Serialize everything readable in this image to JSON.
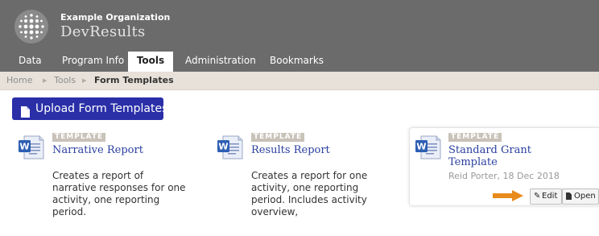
{
  "header": {
    "org_name": "Example Organization",
    "app_name": "DevResults"
  },
  "nav": {
    "items": [
      {
        "label": "Data"
      },
      {
        "label": "Program Info"
      },
      {
        "label": "Tools",
        "active": true
      },
      {
        "label": "Administration"
      },
      {
        "label": "Bookmarks"
      }
    ]
  },
  "breadcrumb": {
    "home": "Home",
    "tools": "Tools",
    "current": "Form Templates"
  },
  "upload_button": {
    "label": "Upload Form Templates",
    "icon": "document-icon"
  },
  "cards": [
    {
      "tag": "TEMPLATE",
      "title": "Narrative Report",
      "description": "Creates a report of narrative responses for one activity, one reporting period.",
      "icon": "word-document-icon"
    },
    {
      "tag": "TEMPLATE",
      "title": "Results Report",
      "description": "Creates a report for one activity, one reporting period. Includes activity overview,",
      "icon": "word-document-icon"
    },
    {
      "tag": "TEMPLATE",
      "title": "Standard Grant Template",
      "meta": "Reid Porter, 18 Dec 2018",
      "icon": "word-document-icon",
      "edit_label": "Edit",
      "open_label": "Open"
    }
  ],
  "colors": {
    "header_bg": "#6b6b6b",
    "breadcrumb_bg": "#e7e1d9",
    "primary_button": "#2a2fa8",
    "link_blue": "#2a3fa0",
    "tag_bg": "#c8c2b8",
    "arrow": "#e98a1c"
  }
}
